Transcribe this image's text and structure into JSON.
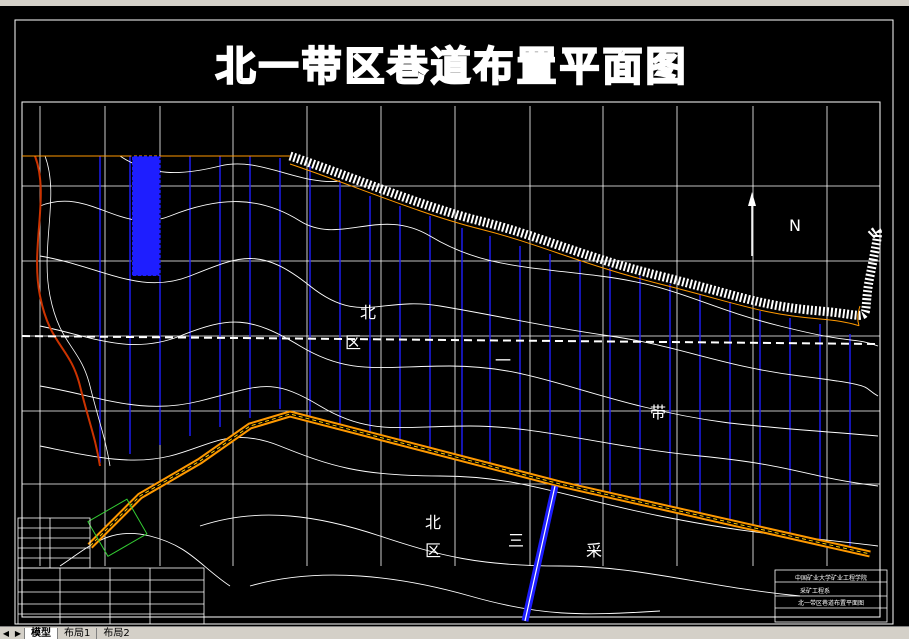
{
  "drawing": {
    "title": "北一带区巷道布置平面图",
    "north_label": "N",
    "area_labels": {
      "upper": [
        "北",
        "区",
        "一",
        "带"
      ],
      "lower": [
        "北",
        "区",
        "三",
        "采"
      ]
    },
    "title_block": {
      "line1": "中国矿业大学矿业工程学院",
      "line2": "采矿工程系",
      "line3": "北一带区巷道布置平面图"
    }
  },
  "colors": {
    "background": "#000000",
    "grid": "#ffffff",
    "panel_lines": "#1e1eff",
    "roadway": "#ff9900",
    "fault": "#cc3300",
    "contour": "#ffffff"
  },
  "layout_tabs": {
    "nav_prev_icon": "◀",
    "nav_next_icon": "▶",
    "tabs": [
      "模型",
      "布局1",
      "布局2"
    ]
  }
}
